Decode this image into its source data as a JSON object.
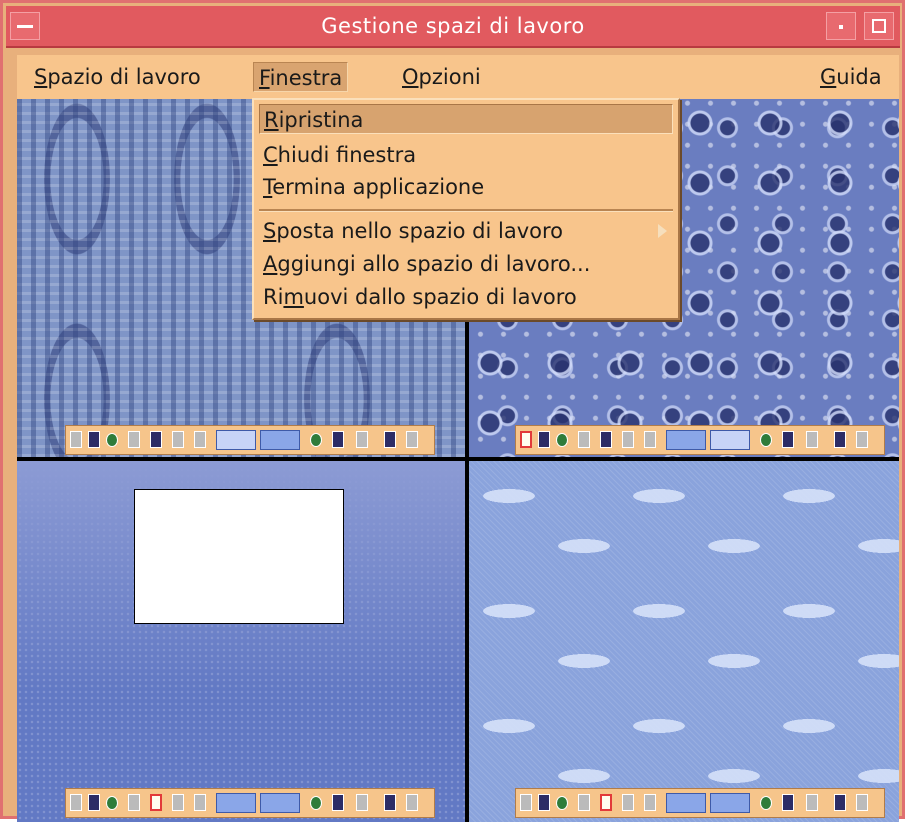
{
  "window": {
    "title": "Gestione spazi di lavoro",
    "menubar": [
      {
        "label": "Spazio di lavoro",
        "mnemonic": "S",
        "rest": "pazio di lavoro"
      },
      {
        "label": "Finestra",
        "mnemonic": "F",
        "rest": "inestra"
      },
      {
        "label": "Opzioni",
        "mnemonic": "O",
        "rest": "pzioni"
      },
      {
        "label": "Guida",
        "mnemonic": "G",
        "rest": "uida"
      }
    ]
  },
  "dropdown": {
    "items": [
      {
        "label": "Ripristina",
        "pre": "",
        "mnemonic": "R",
        "rest": "ipristina",
        "selected": true
      },
      {
        "label": "Chiudi finestra",
        "pre": "",
        "mnemonic": "C",
        "rest": "hiudi finestra"
      },
      {
        "label": "Termina applicazione",
        "pre": "",
        "mnemonic": "T",
        "rest": "ermina applicazione"
      },
      {
        "label": "Sposta nello spazio di lavoro",
        "pre": "",
        "mnemonic": "S",
        "rest": "posta nello spazio di lavoro",
        "submenu": true
      },
      {
        "label": "Aggiungi allo spazio di lavoro...",
        "pre": "",
        "mnemonic": "A",
        "rest": "ggiungi allo spazio di lavoro..."
      },
      {
        "label": "Rimuovi dallo spazio di lavoro",
        "pre": "Ri",
        "mnemonic": "m",
        "rest": "uovi dallo spazio di lavoro"
      }
    ]
  },
  "colors": {
    "titlebar": "#e15a5f",
    "menubar": "#f8c58c",
    "panel": "#f6c58b"
  }
}
